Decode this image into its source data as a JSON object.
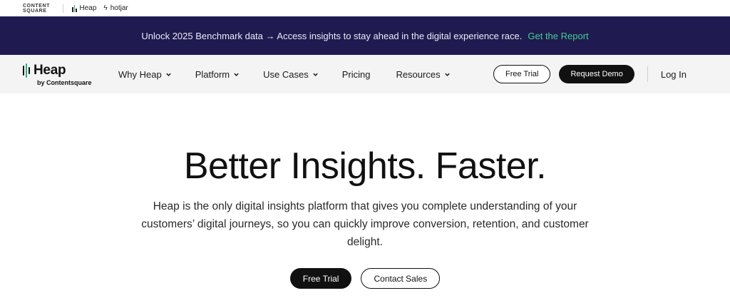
{
  "brandbar": {
    "contentsquare_line1": "CONTENT",
    "contentsquare_line2": "SQUARE",
    "heap": "Heap",
    "hotjar": "hotjar"
  },
  "announcement": {
    "text": "Unlock 2025 Benchmark data → Access insights to stay ahead in the digital experience race.",
    "cta": "Get the Report"
  },
  "nav": {
    "logo_name": "Heap",
    "logo_sub": "by Contentsquare",
    "items": [
      {
        "label": "Why Heap"
      },
      {
        "label": "Platform"
      },
      {
        "label": "Use Cases"
      },
      {
        "label": "Pricing"
      },
      {
        "label": "Resources"
      }
    ],
    "free_trial": "Free Trial",
    "request_demo": "Request Demo",
    "login": "Log In"
  },
  "hero": {
    "title": "Better Insights. Faster.",
    "subtitle": "Heap is the only digital insights platform that gives you complete understanding of your customers’ digital journeys, so you can quickly improve conversion, retention, and customer delight.",
    "primary_cta": "Free Trial",
    "secondary_cta": "Contact Sales"
  },
  "colors": {
    "announce_bg": "#1f1a4f",
    "accent_green": "#3fd08f",
    "nav_bg": "#f4f4f5"
  }
}
